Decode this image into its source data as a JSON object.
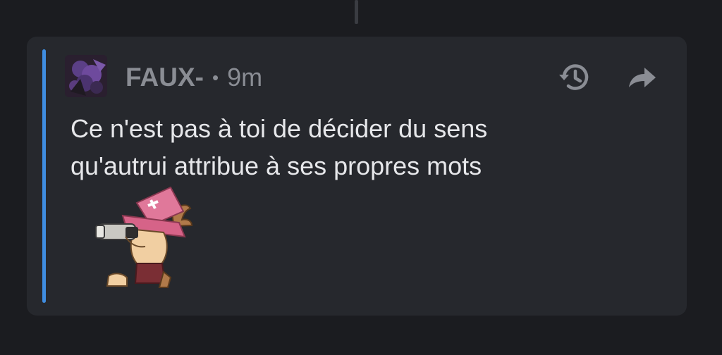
{
  "post": {
    "author": "FAUX-",
    "separator": "•",
    "time": "9m",
    "message_lines": [
      "Ce n'est pas à toi de décider du sens",
      "qu'autrui attribue à ses propres mots"
    ]
  },
  "icons": {
    "history": "history-icon",
    "share": "share-icon",
    "avatar": "avatar-image",
    "sticker": "chopper-sticker"
  },
  "colors": {
    "background": "#1b1c20",
    "card": "#26282d",
    "accent": "#3f8de0",
    "meta_text": "#8a8d94",
    "message_text": "#e6e7ea"
  }
}
